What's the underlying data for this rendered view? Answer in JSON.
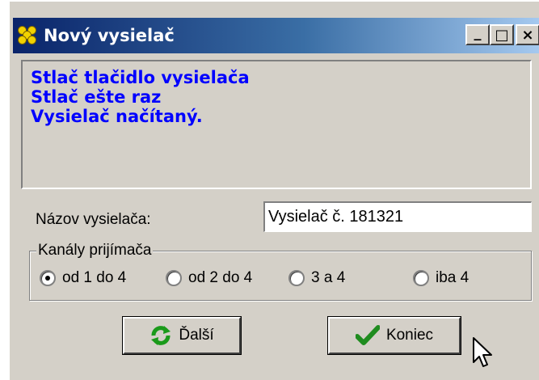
{
  "window": {
    "title": "Nový vysielač",
    "controls": {
      "minimize": "_",
      "maximize": "□",
      "close": "×"
    }
  },
  "log": {
    "lines": [
      "Stlač tlačidlo vysielača",
      "Stlač ešte raz",
      "Vysielač načítaný."
    ],
    "color": "#0000ff"
  },
  "name_field": {
    "label": "Názov vysielača:",
    "value": "Vysielač č. 181321"
  },
  "channels": {
    "legend": "Kanály prijímača",
    "options": [
      {
        "label": "od 1 do 4",
        "selected": true
      },
      {
        "label": "od 2 do 4",
        "selected": false
      },
      {
        "label": "3 a 4",
        "selected": false
      },
      {
        "label": "iba 4",
        "selected": false
      }
    ]
  },
  "buttons": {
    "next": {
      "label": "Ďalší",
      "icon": "refresh-icon"
    },
    "finish": {
      "label": "Koniec",
      "icon": "checkmark-icon"
    }
  },
  "colors": {
    "titlebar_start": "#0a246a",
    "titlebar_end": "#a6caf0",
    "face": "#d4d0c8"
  }
}
